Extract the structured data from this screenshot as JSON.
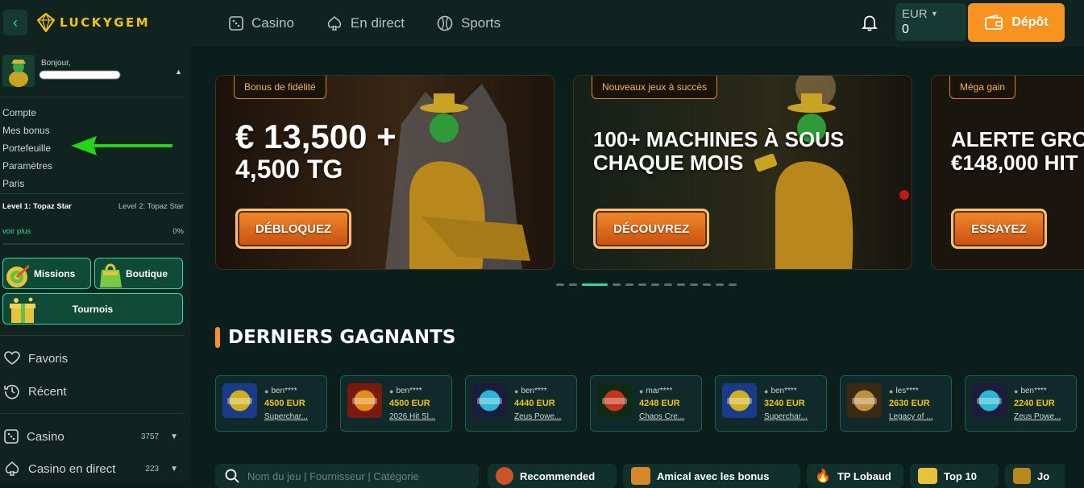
{
  "header": {
    "logo": "LUCKYGEM",
    "nav": [
      {
        "label": "Casino",
        "icon": "dice-icon"
      },
      {
        "label": "En direct",
        "icon": "spade-icon"
      },
      {
        "label": "Sports",
        "icon": "ball-icon"
      }
    ],
    "balance_currency": "EUR",
    "balance_amount": "0",
    "deposit_label": "Dépôt"
  },
  "sidebar": {
    "greeting": "Bonjour,",
    "menu": [
      "Compte",
      "Mes bonus",
      "Portefeuille",
      "Paramètres",
      "Paris"
    ],
    "level_current": "Level 1: Topaz Star",
    "level_next": "Level 2: Topaz Star",
    "see_more": "voir plus",
    "progress_pct": "0%",
    "progress_value": 0,
    "tiles": {
      "missions": "Missions",
      "boutique": "Boutique",
      "tournois": "Tournois"
    },
    "favoris": "Favoris",
    "recent": "Récent",
    "casino": {
      "label": "Casino",
      "count": "3757"
    },
    "casino_live": {
      "label": "Casino en direct",
      "count": "223"
    }
  },
  "banners": [
    {
      "badge": "Bonus de fidélité",
      "title_line1": "€ 13,500 +",
      "title_line2": "4,500 TG",
      "cta": "DÉBLOQUEZ"
    },
    {
      "badge": "Nouveaux jeux à succès",
      "title_line1": "100+ MACHINES À SOUS",
      "title_line2": "CHAQUE MOIS",
      "cta": "DÉCOUVREZ"
    },
    {
      "badge": "Méga gain",
      "title_line1": "ALERTE GRO",
      "title_line2": "€148,000 HIT",
      "cta": "ESSAYEZ"
    }
  ],
  "carousel": {
    "dot_count": 13,
    "active_index": 2
  },
  "winners": {
    "title": "DERNIERS GAGNANTS",
    "items": [
      {
        "user": "ben****",
        "amount": "4500 EUR",
        "game": "Superchar..."
      },
      {
        "user": "ben****",
        "amount": "4500 EUR",
        "game": "2026 Hit Sl..."
      },
      {
        "user": "ben****",
        "amount": "4440 EUR",
        "game": "Zeus Powe..."
      },
      {
        "user": "mar****",
        "amount": "4248 EUR",
        "game": "Chaos Cre..."
      },
      {
        "user": "ben****",
        "amount": "3240 EUR",
        "game": "Superchar..."
      },
      {
        "user": "les****",
        "amount": "2630 EUR",
        "game": "Legacy of ..."
      },
      {
        "user": "ben****",
        "amount": "2240 EUR",
        "game": "Zeus Powe..."
      }
    ]
  },
  "bottom": {
    "search_placeholder": "Nom du jeu | Fournisseur | Catégorie",
    "tabs": [
      "Recommended",
      "Amical avec les bonus",
      "TP Lobaud",
      "Top 10",
      "Jo"
    ]
  },
  "colors": {
    "accent": "#2fd9a4",
    "deposit": "#f7931e",
    "gold": "#f1c40f",
    "bg": "#0c1e1b"
  }
}
